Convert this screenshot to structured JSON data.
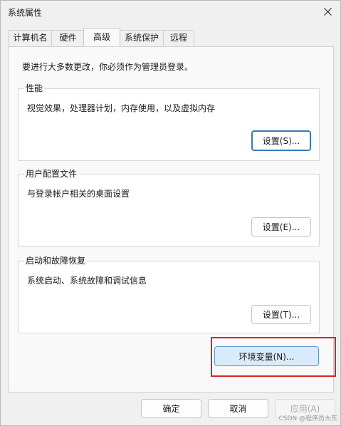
{
  "window": {
    "title": "系统属性"
  },
  "tabs": [
    {
      "label": "计算机名",
      "active": false
    },
    {
      "label": "硬件",
      "active": false
    },
    {
      "label": "高级",
      "active": true
    },
    {
      "label": "系统保护",
      "active": false
    },
    {
      "label": "远程",
      "active": false
    }
  ],
  "intro": "要进行大多数更改，你必须作为管理员登录。",
  "groups": {
    "performance": {
      "title": "性能",
      "description": "视觉效果，处理器计划，内存使用，以及虚拟内存",
      "button": "设置(S)..."
    },
    "user_profiles": {
      "title": "用户配置文件",
      "description": "与登录帐户相关的桌面设置",
      "button": "设置(E)..."
    },
    "startup_recovery": {
      "title": "启动和故障恢复",
      "description": "系统启动、系统故障和调试信息",
      "button": "设置(T)..."
    }
  },
  "env_button": "环境变量(N)...",
  "footer": {
    "ok": "确定",
    "cancel": "取消",
    "apply": "应用(A)"
  },
  "watermark": "CSDN @程序员大东",
  "colors": {
    "highlight": "#e02020",
    "accent": "#3c78b4"
  }
}
